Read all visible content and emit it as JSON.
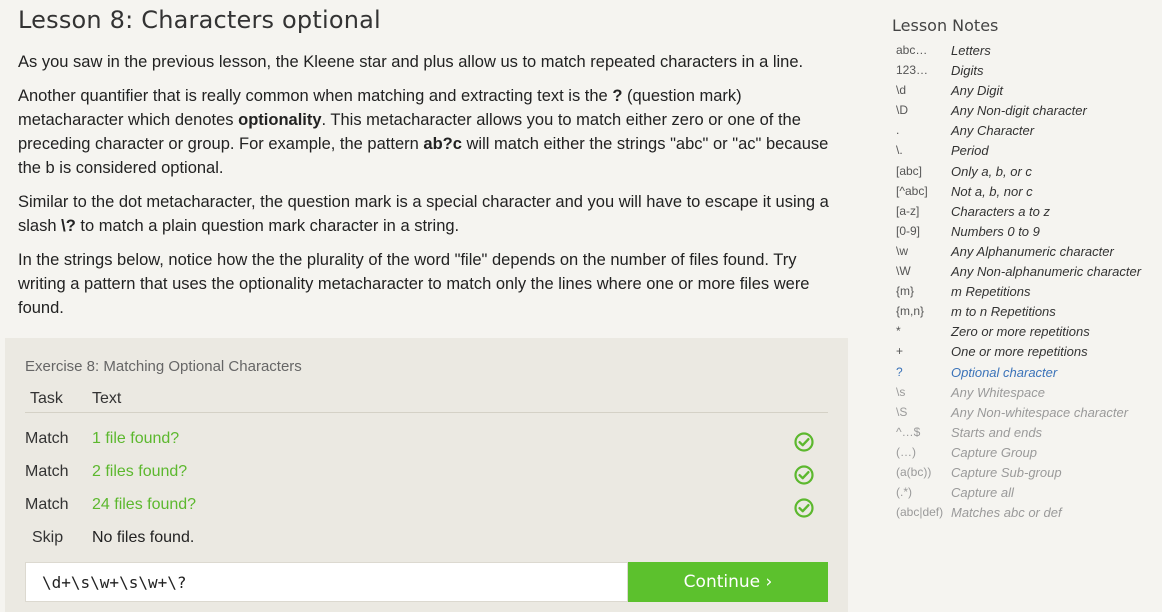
{
  "lesson": {
    "title": "Lesson 8: Characters optional",
    "paragraphs": [
      [
        {
          "t": "As you saw in the previous lesson, the Kleene star and plus allow us to match repeated characters in a line.",
          "b": false
        }
      ],
      [
        {
          "t": "Another quantifier that is really common when matching and extracting text is the ",
          "b": false
        },
        {
          "t": "?",
          "b": true
        },
        {
          "t": " (question mark) metacharacter which denotes ",
          "b": false
        },
        {
          "t": "optionality",
          "b": true
        },
        {
          "t": ". This metacharacter allows you to match either zero or one of the preceding character or group. For example, the pattern ",
          "b": false
        },
        {
          "t": "ab?c",
          "b": true
        },
        {
          "t": " will match either the strings \"abc\" or \"ac\" because the b is considered optional.",
          "b": false
        }
      ],
      [
        {
          "t": "Similar to the dot metacharacter, the question mark is a special character and you will have to escape it using a slash ",
          "b": false
        },
        {
          "t": "\\?",
          "b": true
        },
        {
          "t": " to match a plain question mark character in a string.",
          "b": false
        }
      ],
      [
        {
          "t": "In the strings below, notice how the the plurality of the word \"file\" depends on the number of files found. Try writing a pattern that uses the optionality metacharacter to match only the lines where one or more files were found.",
          "b": false
        }
      ]
    ]
  },
  "exercise": {
    "title": "Exercise 8: Matching Optional Characters",
    "col_task": "Task",
    "col_text": "Text",
    "rows": [
      {
        "task": "Match",
        "text": "1 file found?",
        "kind": "match",
        "done": true
      },
      {
        "task": "Match",
        "text": "2 files found?",
        "kind": "match",
        "done": true
      },
      {
        "task": "Match",
        "text": "24 files found?",
        "kind": "match",
        "done": true
      },
      {
        "task": "Skip",
        "text": "No files found.",
        "kind": "skip",
        "done": false
      }
    ],
    "input_value": "\\d+\\s\\w+\\s\\w+\\?",
    "continue_label": "Continue ›",
    "check_color": "#5cb82e"
  },
  "notes": {
    "title": "Lesson Notes",
    "items": [
      {
        "sym": "abc…",
        "desc": "Letters",
        "state": "past"
      },
      {
        "sym": "123…",
        "desc": "Digits",
        "state": "past"
      },
      {
        "sym": "\\d",
        "desc": "Any Digit",
        "state": "past"
      },
      {
        "sym": "\\D",
        "desc": "Any Non-digit character",
        "state": "past"
      },
      {
        "sym": ".",
        "desc": "Any Character",
        "state": "past"
      },
      {
        "sym": "\\.",
        "desc": "Period",
        "state": "past"
      },
      {
        "sym": "[abc]",
        "desc": "Only a, b, or c",
        "state": "past"
      },
      {
        "sym": "[^abc]",
        "desc": "Not a, b, nor c",
        "state": "past"
      },
      {
        "sym": "[a-z]",
        "desc": "Characters a to z",
        "state": "past"
      },
      {
        "sym": "[0-9]",
        "desc": "Numbers 0 to 9",
        "state": "past"
      },
      {
        "sym": "\\w",
        "desc": "Any Alphanumeric character",
        "state": "past"
      },
      {
        "sym": "\\W",
        "desc": "Any Non-alphanumeric character",
        "state": "past"
      },
      {
        "sym": "{m}",
        "desc": "m Repetitions",
        "state": "past"
      },
      {
        "sym": "{m,n}",
        "desc": "m to n Repetitions",
        "state": "past"
      },
      {
        "sym": "*",
        "desc": "Zero or more repetitions",
        "state": "past"
      },
      {
        "sym": "+",
        "desc": "One or more repetitions",
        "state": "past"
      },
      {
        "sym": "?",
        "desc": "Optional character",
        "state": "current"
      },
      {
        "sym": "\\s",
        "desc": "Any Whitespace",
        "state": "future"
      },
      {
        "sym": "\\S",
        "desc": "Any Non-whitespace character",
        "state": "future"
      },
      {
        "sym": "^…$",
        "desc": "Starts and ends",
        "state": "future"
      },
      {
        "sym": "(…)",
        "desc": "Capture Group",
        "state": "future"
      },
      {
        "sym": "(a(bc))",
        "desc": "Capture Sub-group",
        "state": "future"
      },
      {
        "sym": "(.*)",
        "desc": "Capture all",
        "state": "future"
      },
      {
        "sym": "(abc|def)",
        "desc": "Matches abc or def",
        "state": "future"
      }
    ],
    "colors": {
      "past": "#333333",
      "current": "#3b73b9",
      "future": "#9a9a9a"
    }
  }
}
